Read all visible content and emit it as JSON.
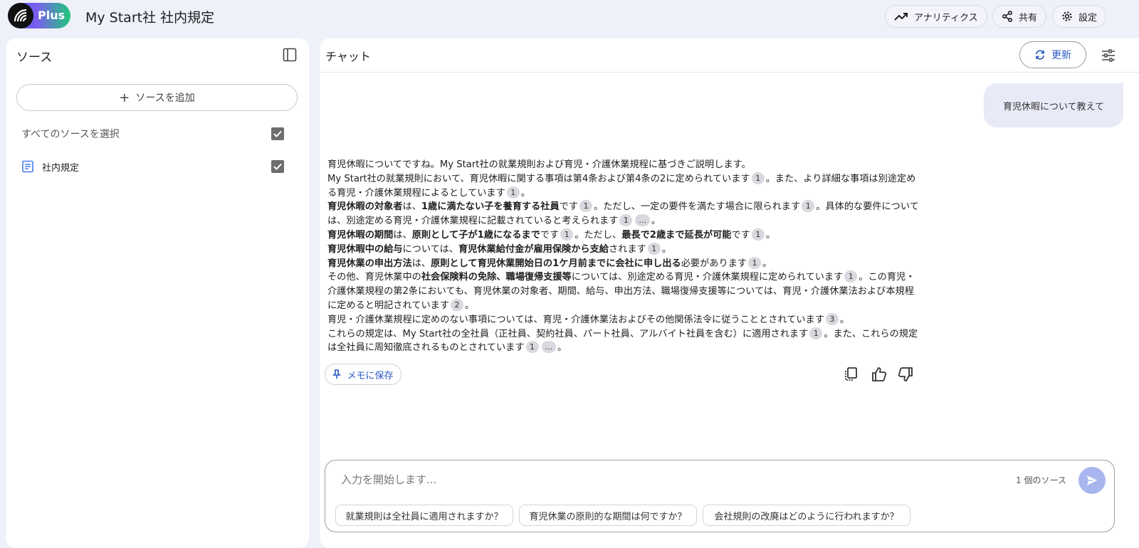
{
  "header": {
    "logo_text": "Plus",
    "title": "My Start社 社内規定",
    "analytics_label": "アナリティクス",
    "share_label": "共有",
    "settings_label": "設定"
  },
  "sources": {
    "title": "ソース",
    "add_label": "ソースを追加",
    "select_all_label": "すべてのソースを選択",
    "items": [
      {
        "label": "社内規定",
        "checked": true
      }
    ]
  },
  "chat": {
    "title": "チャット",
    "refresh_label": "更新",
    "user_message": "育児休暇について教えて",
    "answer": {
      "l1": "育児休暇についてですね。My Start社の就業規則および育児・介護休業規程に基づきご説明します。",
      "l2a": "My Start社の就業規則において、育児休暇に関する事項は第4条および第4条の2に定められています",
      "l2b": "。また、より詳細な事項は別途定める育児・介護休業規程によるとしています",
      "l3a": "育児休暇の対象者",
      "l3b": "は、",
      "l3c": "1歳に満たない子を養育する社員",
      "l3d": "です",
      "l3e": "。ただし、一定の要件を満たす場合に限られます",
      "l3f": "。具体的な要件については、別途定める育児・介護休業規程に記載されていると考えられます",
      "l4a": "育児休暇の期間",
      "l4b": "は、",
      "l4c": "原則として子が1歳になるまで",
      "l4d": "です",
      "l4e": "。ただし、",
      "l4f": "最長で2歳まで延長が可能",
      "l4g": "です",
      "l5a": "育児休暇中の給与",
      "l5b": "については、",
      "l5c": "育児休業給付金が雇用保険から支給",
      "l5d": "されます",
      "l6a": "育児休業の申出方法",
      "l6b": "は、",
      "l6c": "原則として育児休業開始日の1ケ月前までに会社に申し出る",
      "l6d": "必要があります",
      "l7a": "その他、育児休業中の",
      "l7b": "社会保険料の免除、職場復帰支援等",
      "l7c": "については、別途定める育児・介護休業規程に定められています",
      "l7d": "。この育児・介護休業規程の第2条においても、育児休業の対象者、期間、給与、申出方法、職場復帰支援等については、育児・介護休業法および本規程に定めると明記されています",
      "l8": "育児・介護休業規程に定めのない事項については、育児・介護休業法およびその他関係法令に従うこととされています",
      "l9a": "これらの規定は、My Start社の全社員（正社員、契約社員、パート社員、アルバイト社員を含む）に適用されます",
      "l9b": "。また、これらの規定は全社員に周知徹底されるものとされています",
      "cite1": "1",
      "cite2": "2",
      "cite3": "3",
      "cite_more": "...",
      "period": "。"
    },
    "save_memo_label": "メモに保存",
    "input_placeholder": "入力を開始します...",
    "source_count": "1 個のソース",
    "suggestions": [
      "就業規則は全社員に適用されますか？",
      "育児休業の原則的な期間は何ですか？",
      "会社規則の改廃はどのように行われますか？"
    ]
  }
}
